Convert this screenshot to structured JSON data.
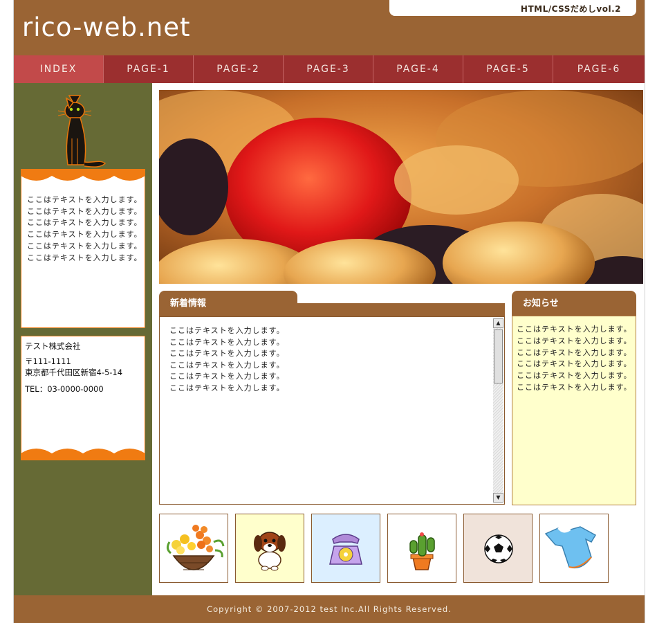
{
  "header": {
    "site_title": "rico-web.net",
    "tagline": "HTML/CSSだめしvol.2"
  },
  "nav": {
    "items": [
      {
        "label": "INDEX",
        "active": true
      },
      {
        "label": "PAGE-1",
        "active": false
      },
      {
        "label": "PAGE-2",
        "active": false
      },
      {
        "label": "PAGE-3",
        "active": false
      },
      {
        "label": "PAGE-4",
        "active": false
      },
      {
        "label": "PAGE-5",
        "active": false
      },
      {
        "label": "PAGE-6",
        "active": false
      }
    ]
  },
  "sidebar": {
    "texts": [
      "ここはテキストを入力します。",
      "ここはテキストを入力します。",
      "ここはテキストを入力します。",
      "ここはテキストを入力します。",
      "ここはテキストを入力します。",
      "ここはテキストを入力します。"
    ],
    "company": {
      "name": "テスト株式会社",
      "postal": "〒111-1111",
      "address": "東京都千代田区新宿4-5-14",
      "tel": "TEL：03-0000-0000"
    }
  },
  "news": {
    "title": "新着情報",
    "texts": [
      "ここはテキストを入力します。",
      "ここはテキストを入力します。",
      "ここはテキストを入力します。",
      "ここはテキストを入力します。",
      "ここはテキストを入力します。",
      "ここはテキストを入力します。"
    ]
  },
  "notice": {
    "title": "お知らせ",
    "texts": [
      "ここはテキストを入力します。",
      "ここはテキストを入力します。",
      "ここはテキストを入力します。",
      "ここはテキストを入力します。",
      "ここはテキストを入力します。",
      "ここはテキストを入力します。"
    ]
  },
  "thumbnails": [
    {
      "icon": "flower-basket-icon",
      "bg": "#ffffff"
    },
    {
      "icon": "puppy-icon",
      "bg": "#ffffcc"
    },
    {
      "icon": "telephone-icon",
      "bg": "#dcefff"
    },
    {
      "icon": "cactus-icon",
      "bg": "#ffffff"
    },
    {
      "icon": "soccer-ball-icon",
      "bg": "#f0e3da"
    },
    {
      "icon": "baby-clothes-icon",
      "bg": "#ffffff"
    }
  ],
  "footer": {
    "copyright": "Copyright © 2007-2012 test Inc.All Rights Reserved."
  },
  "colors": {
    "header_brown": "#9a6434",
    "nav_red": "#9b2f2f",
    "nav_active": "#c24a4a",
    "sidebar_olive": "#666a35",
    "accent_orange": "#f07b12",
    "notice_bg": "#ffffcc"
  }
}
